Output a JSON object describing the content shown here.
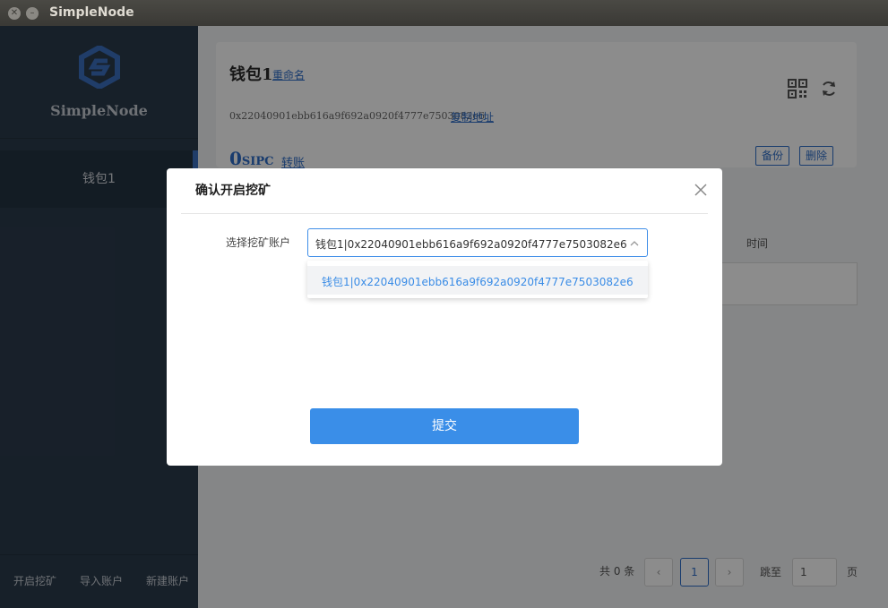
{
  "window": {
    "title": "SimpleNode"
  },
  "sidebar": {
    "brand": "SimpleNode",
    "items": [
      {
        "label": "钱包1"
      }
    ],
    "actions": {
      "start_mining": "开启挖矿",
      "import_account": "导入账户",
      "new_account": "新建账户"
    }
  },
  "wallet": {
    "name": "钱包1",
    "rename_label": "重命名",
    "address": "0x22040901ebb616a9f692a0920f4777e7503082e6",
    "copy_label": "复制地址",
    "balance": "0",
    "unit": "SIPC",
    "transfer_label": "转账",
    "backup_label": "备份",
    "delete_label": "删除"
  },
  "table": {
    "time_header": "时间"
  },
  "pagination": {
    "total_text": "共 0 条",
    "current_page": "1",
    "jump_label": "跳至",
    "jump_value": "1",
    "page_unit": "页",
    "prev": "‹",
    "next": "›"
  },
  "modal": {
    "title": "确认开启挖矿",
    "field_label": "选择挖矿账户",
    "selected_value": "钱包1|0x22040901ebb616a9f692a0920f4777e7503082e6",
    "options": [
      "钱包1|0x22040901ebb616a9f692a0920f4777e7503082e6"
    ],
    "submit_label": "提交"
  },
  "colors": {
    "accent": "#3a8ee8",
    "sidebar_bg": "#2b3b4c",
    "link": "#2f6ec8"
  }
}
